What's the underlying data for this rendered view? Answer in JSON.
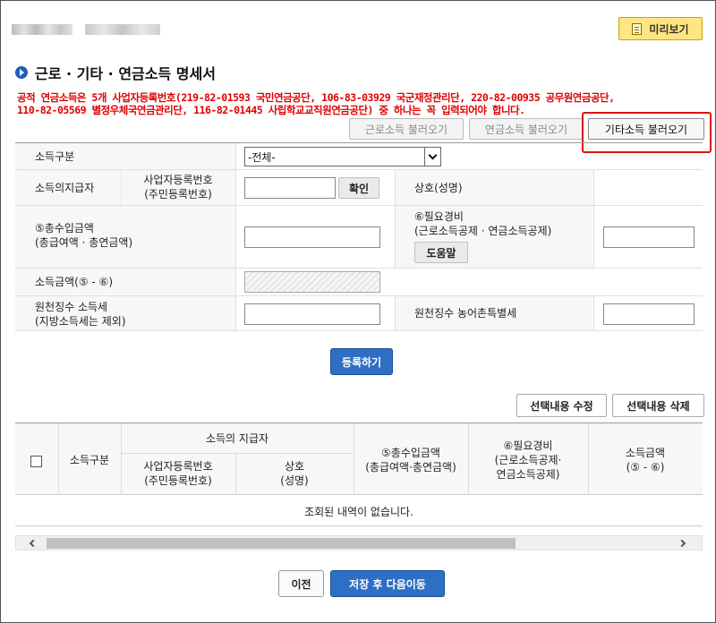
{
  "header": {
    "preview_label": "미리보기"
  },
  "page_title": "근로 · 기타 · 연금소득 명세서",
  "notice": {
    "line1": "공적 연금소득은 5개 사업자등록번호(219-82-01593 국민연금공단, 106-83-03929 국군재정관리단, 220-82-00935 공무원연금공단,",
    "line2": "110-82-05569 별정우체국연금관리단, 116-82-01445 사립학교교직원연금공단) 중 하나는 꼭 입력되어야 합니다."
  },
  "load_buttons": {
    "labor": "근로소득 불러오기",
    "pension": "연금소득 불러오기",
    "other": "기타소득 불러오기"
  },
  "form": {
    "income_type_label": "소득구분",
    "income_type_selected": "-전체-",
    "payer_label": "소득의지급자",
    "biz_no_label_1": "사업자등록번호",
    "biz_no_label_2": "(주민등록번호)",
    "confirm_label": "확인",
    "company_label": "상호(성명)",
    "gross_label_1": "⑤총수입금액",
    "gross_label_2": "(총급여액 · 총연금액)",
    "expense_label_1": "⑥필요경비",
    "expense_label_2": "(근로소득공제 · 연금소득공제)",
    "help_label": "도움말",
    "income_amount_label": "소득금액(⑤ - ⑥)",
    "withholding_label_1": "원천징수 소득세",
    "withholding_label_2": "(지방소득세는 제외)",
    "rural_tax_label": "원천징수 농어촌특별세"
  },
  "register_label": "등록하기",
  "edit_selected_label": "선택내용 수정",
  "delete_selected_label": "선택내용 삭제",
  "grid": {
    "col_income_type": "소득구분",
    "col_payer": "소득의 지급자",
    "col_biz_no_1": "사업자등록번호",
    "col_biz_no_2": "(주민등록번호)",
    "col_company_1": "상호",
    "col_company_2": "(성명)",
    "col_gross_1": "⑤총수입금액",
    "col_gross_2": "(총급여액·총연금액)",
    "col_expense_1": "⑥필요경비",
    "col_expense_2": "(근로소득공제·",
    "col_expense_3": "연금소득공제)",
    "col_income_1": "소득금액",
    "col_income_2": "(⑤ - ⑥)",
    "empty_message": "조회된 내역이 없습니다."
  },
  "footer": {
    "prev_label": "이전",
    "save_next_label": "저장 후 다음이동"
  },
  "colors": {
    "primary": "#2d6fc4",
    "notice_red": "#e00000",
    "preview_yellow": "#ffe680",
    "highlight_red": "#e01010"
  }
}
